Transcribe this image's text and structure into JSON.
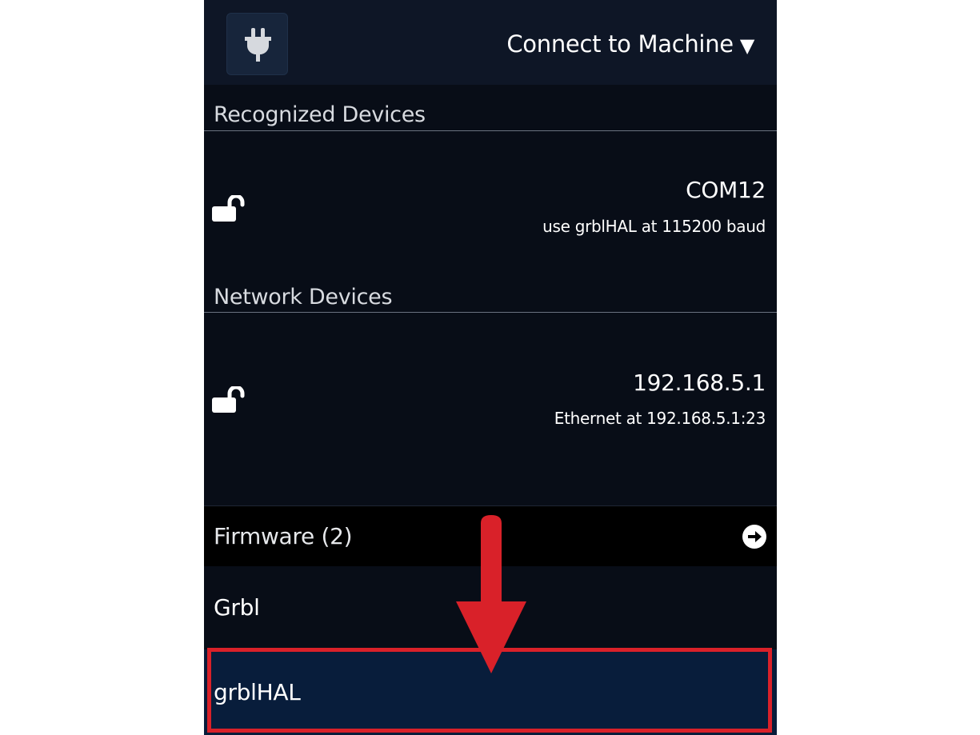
{
  "header": {
    "title": "Connect to Machine",
    "caret": "▼",
    "connect_icon": "plug-icon"
  },
  "recognized": {
    "label": "Recognized Devices",
    "devices": [
      {
        "name": "COM12",
        "description": "use grblHAL at 115200 baud",
        "icon": "unlocked-padlock-icon"
      }
    ]
  },
  "network": {
    "label": "Network Devices",
    "devices": [
      {
        "name": "192.168.5.1",
        "description": "Ethernet at 192.168.5.1:23",
        "icon": "unlocked-padlock-icon"
      }
    ]
  },
  "firmware": {
    "title": "Firmware (2)",
    "nav_icon": "circle-arrow-right-icon",
    "items": [
      {
        "label": "Grbl",
        "selected": false
      },
      {
        "label": "grblHAL",
        "selected": true
      }
    ]
  },
  "annotation": {
    "arrow_icon": "red-down-arrow-icon",
    "highlight_color": "#d92129"
  },
  "colors": {
    "panel_bg": "#080d17",
    "header_bg": "#0e1626",
    "selected_bg": "#081d3b",
    "accent_red": "#d92129"
  }
}
